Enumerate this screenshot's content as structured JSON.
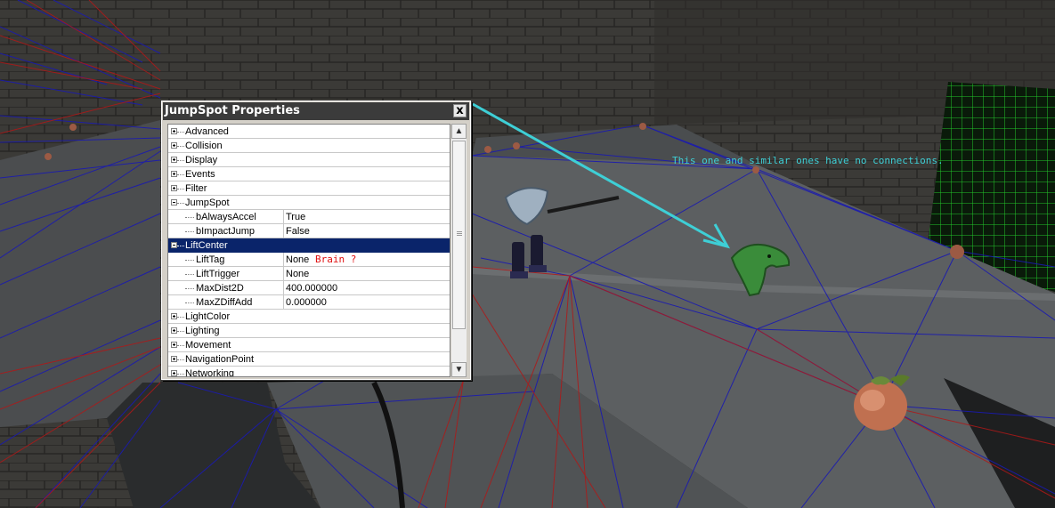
{
  "window": {
    "title": "JumpSpot Properties",
    "close_label": "x"
  },
  "properties": [
    {
      "kind": "category",
      "label": "Advanced",
      "expanded": false
    },
    {
      "kind": "category",
      "label": "Collision",
      "expanded": false
    },
    {
      "kind": "category",
      "label": "Display",
      "expanded": false
    },
    {
      "kind": "category",
      "label": "Events",
      "expanded": false
    },
    {
      "kind": "category",
      "label": "Filter",
      "expanded": false
    },
    {
      "kind": "category",
      "label": "JumpSpot",
      "expanded": true
    },
    {
      "kind": "property",
      "label": "bAlwaysAccel",
      "value": "True"
    },
    {
      "kind": "property",
      "label": "bImpactJump",
      "value": "False"
    },
    {
      "kind": "category",
      "label": "LiftCenter",
      "expanded": true,
      "selected": true
    },
    {
      "kind": "property",
      "label": "LiftTag",
      "value": "None"
    },
    {
      "kind": "property",
      "label": "LiftTrigger",
      "value": "None"
    },
    {
      "kind": "property",
      "label": "MaxDist2D",
      "value": "400.000000"
    },
    {
      "kind": "property",
      "label": "MaxZDiffAdd",
      "value": "0.000000"
    },
    {
      "kind": "category",
      "label": "LightColor",
      "expanded": false
    },
    {
      "kind": "category",
      "label": "Lighting",
      "expanded": false
    },
    {
      "kind": "category",
      "label": "Movement",
      "expanded": false
    },
    {
      "kind": "category",
      "label": "NavigationPoint",
      "expanded": false
    },
    {
      "kind": "category",
      "label": "Networking",
      "expanded": false
    }
  ],
  "annotations": {
    "brain_note": "Brain ?",
    "connections_note": "This one and similar ones have no connections."
  },
  "colors": {
    "annotation_cyan": "#3ecfd6",
    "annotation_red": "#e01010",
    "selection_blue": "#0a246a",
    "path_blue": "#1a1ab0",
    "path_red": "#b01818"
  }
}
